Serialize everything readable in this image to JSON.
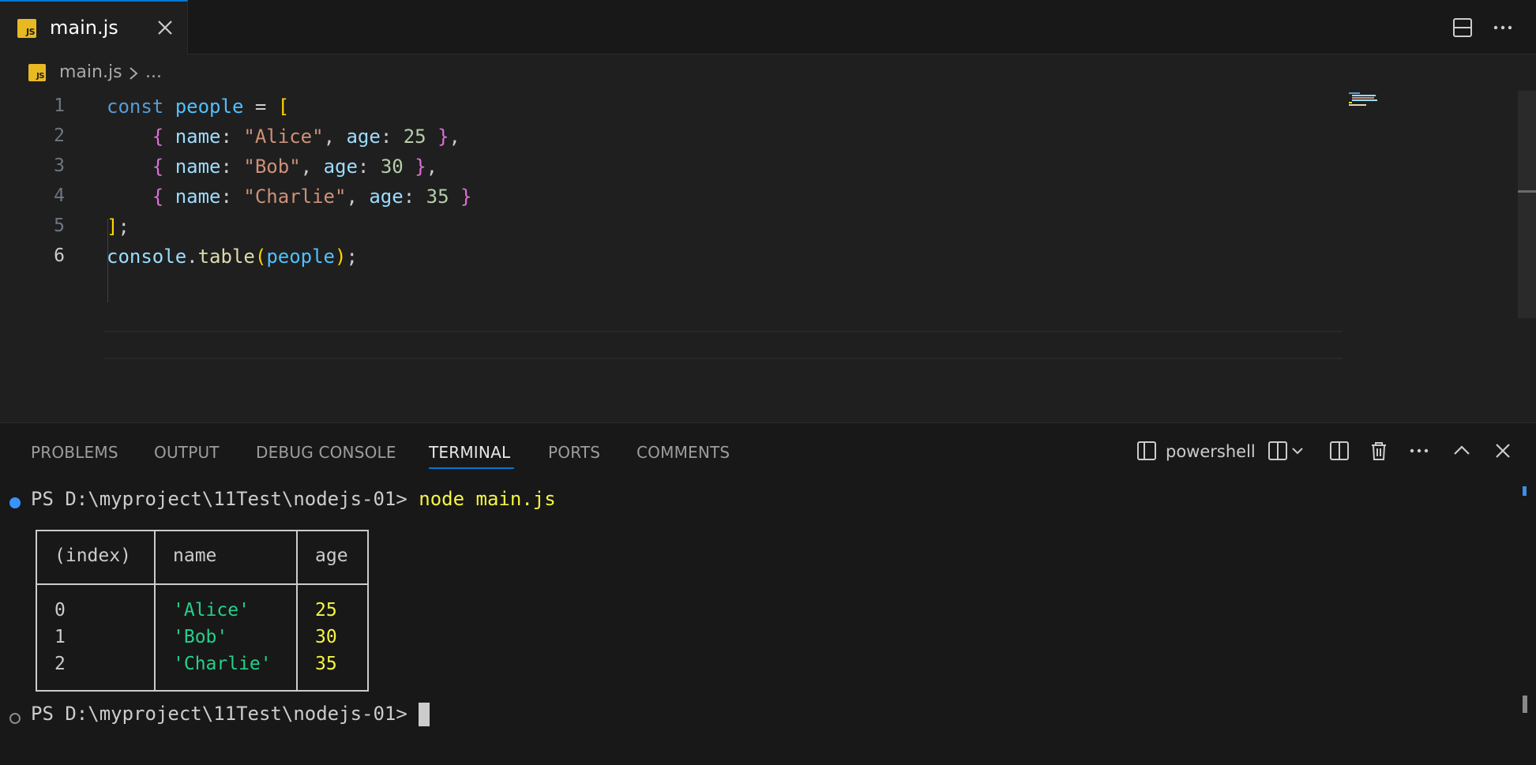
{
  "tab": {
    "icon": "JS",
    "label": "main.js"
  },
  "breadcrumb": {
    "icon": "JS",
    "file": "main.js",
    "more": "..."
  },
  "editor": {
    "line_numbers": [
      "1",
      "2",
      "3",
      "4",
      "5",
      "6"
    ],
    "active_line": "6",
    "lines": [
      "const people = [",
      "    { name: \"Alice\", age: 25 },",
      "    { name: \"Bob\", age: 30 },",
      "    { name: \"Charlie\", age: 35 }",
      "];",
      "console.table(people);"
    ]
  },
  "panel": {
    "tabs": [
      "PROBLEMS",
      "OUTPUT",
      "DEBUG CONSOLE",
      "TERMINAL",
      "PORTS",
      "COMMENTS"
    ],
    "active_tab": "TERMINAL",
    "shell_label": "powershell"
  },
  "terminal": {
    "prompt1": "PS D:\\myproject\\11Test\\nodejs-01>",
    "command": "node main.js",
    "table": {
      "headers": [
        "(index)",
        "name",
        "age"
      ],
      "rows": [
        {
          "index": "0",
          "name": "'Alice'",
          "age": "25"
        },
        {
          "index": "1",
          "name": "'Bob'",
          "age": "30"
        },
        {
          "index": "2",
          "name": "'Charlie'",
          "age": "35"
        }
      ]
    },
    "prompt2": "PS D:\\myproject\\11Test\\nodejs-01>"
  },
  "colors": {
    "accent": "#0078d4",
    "js_icon": "#e8b923",
    "terminal_string": "#23d18b",
    "terminal_number": "#f5f543",
    "status_dot_success": "#3794ff"
  }
}
